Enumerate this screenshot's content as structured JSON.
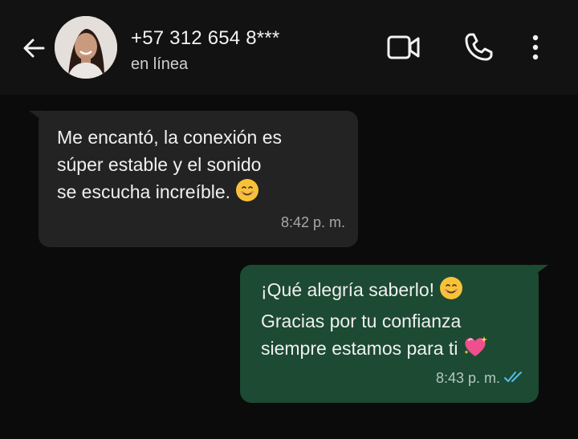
{
  "header": {
    "contact_name": "+57 312 654 8***",
    "status": "en línea",
    "icons": [
      "back-arrow-icon",
      "avatar",
      "video-call-icon",
      "phone-icon",
      "more-options-icon"
    ]
  },
  "messages": [
    {
      "direction": "incoming",
      "lines": [
        "Me encantó, la conexión es",
        "súper estable y el sonido",
        "se escucha increíble."
      ],
      "emoji": "smiling-face-emoji",
      "time": "8:42 p. m."
    },
    {
      "direction": "outgoing",
      "lines": [
        "¡Qué alegría saberlo!",
        "Gracias por tu confianza",
        "siempre estamos para ti"
      ],
      "emojis": [
        "smiling-face-emoji",
        "sparkling-heart-emoji"
      ],
      "time": "8:43 p. m.",
      "status": "read-double-check-icon"
    }
  ],
  "colors": {
    "background": "#0b0b0b",
    "header": "#121212",
    "incoming_bubble": "#232323",
    "outgoing_bubble": "#1c4a33",
    "read_ticks": "#53bdeb"
  }
}
